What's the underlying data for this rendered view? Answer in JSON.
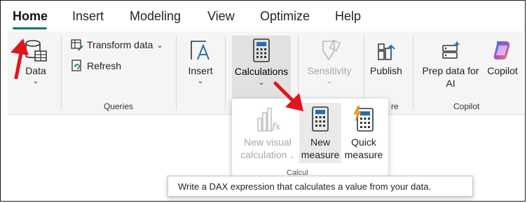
{
  "tabs": [
    {
      "label": "Home",
      "active": true
    },
    {
      "label": "Insert"
    },
    {
      "label": "Modeling"
    },
    {
      "label": "View"
    },
    {
      "label": "Optimize"
    },
    {
      "label": "Help"
    }
  ],
  "ribbon": {
    "data": {
      "label": "Data",
      "icon": "database-table-icon"
    },
    "queries": {
      "transform_label": "Transform data",
      "refresh_label": "Refresh",
      "group_label": "Queries"
    },
    "insert": {
      "label": "Insert",
      "icon": "text-box-icon"
    },
    "calculations": {
      "label": "Calculations",
      "icon": "calculator-icon",
      "selected": true
    },
    "sensitivity": {
      "label": "Sensitivity",
      "icon": "sensitivity-label-icon",
      "disabled": true
    },
    "publish": {
      "label": "Publish",
      "icon": "publish-icon",
      "group_label_partial": "re"
    },
    "copilot": {
      "prep_label_line1": "Prep data for",
      "prep_label_line2": "AI",
      "copilot_label": "Copilot",
      "group_label": "Copilot"
    }
  },
  "calculations_menu": {
    "new_visual_calc_line1": "New visual",
    "new_visual_calc_line2": "calculation",
    "new_measure_line1": "New",
    "new_measure_line2": "measure",
    "quick_measure_line1": "Quick",
    "quick_measure_line2": "measure",
    "group_label_partial": "Calcul"
  },
  "tooltip": {
    "text": "Write a DAX expression that calculates a value from your data."
  },
  "colors": {
    "accent": "#117865",
    "annotation_arrow": "#e0161c",
    "disabled": "#a8a8a8"
  }
}
